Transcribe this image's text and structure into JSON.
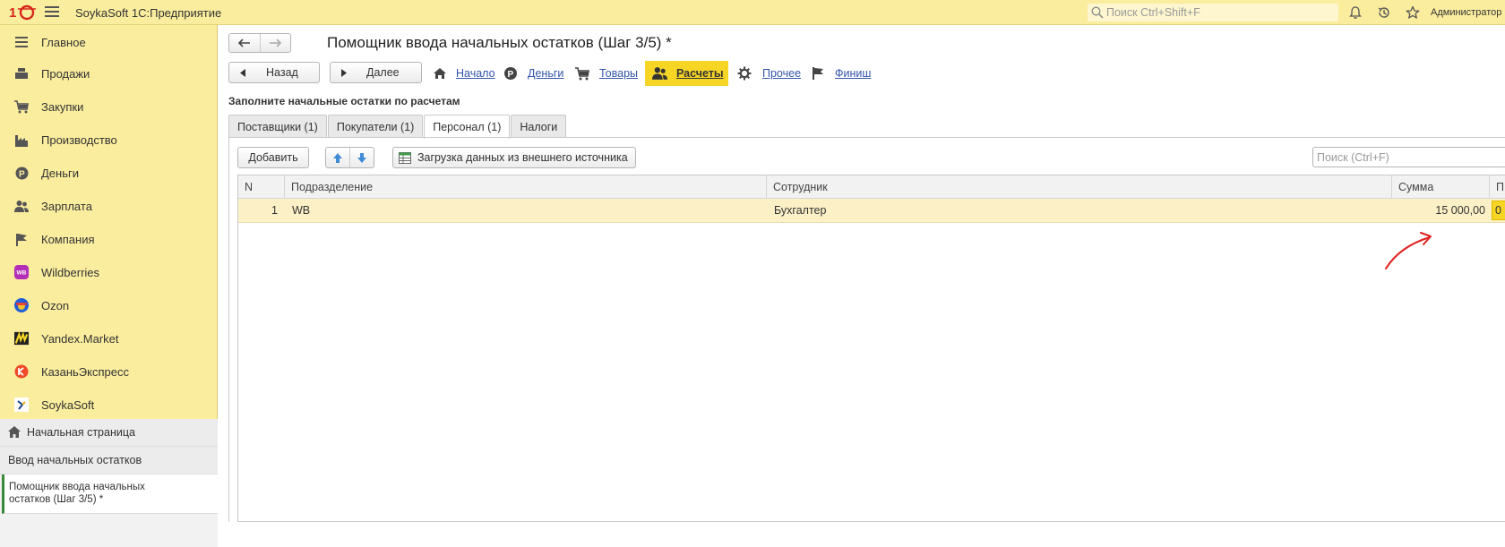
{
  "app": {
    "title": "SoykaSoft 1С:Предприятие",
    "search_placeholder": "Поиск Ctrl+Shift+F",
    "user": "Администратор",
    "accent": "#fbed9e"
  },
  "sidebar": {
    "items": [
      {
        "label": "Главное",
        "icon": "menu-lines-icon"
      },
      {
        "label": "Продажи",
        "icon": "cash-register-icon"
      },
      {
        "label": "Закупки",
        "icon": "cart-icon"
      },
      {
        "label": "Производство",
        "icon": "factory-icon"
      },
      {
        "label": "Деньги",
        "icon": "ruble-coin-icon"
      },
      {
        "label": "Зарплата",
        "icon": "people-icon"
      },
      {
        "label": "Компания",
        "icon": "flag-icon"
      },
      {
        "label": "Wildberries",
        "icon": "wildberries-logo-icon"
      },
      {
        "label": "Ozon",
        "icon": "ozon-logo-icon"
      },
      {
        "label": "Yandex.Market",
        "icon": "yandex-market-logo-icon"
      },
      {
        "label": "КазаньЭкспресс",
        "icon": "kazanexpress-logo-icon"
      },
      {
        "label": "SoykaSoft",
        "icon": "soykasoft-logo-icon"
      }
    ],
    "home": "Начальная страница",
    "open_windows": [
      "Ввод начальных остатков",
      "Помощник ввода начальных остатков (Шаг 3/5) *"
    ]
  },
  "form": {
    "title": "Помощник ввода начальных остатков (Шаг 3/5) *",
    "back_label": "Назад",
    "next_label": "Далее",
    "steps": [
      "Начало",
      "Деньги",
      "Товары",
      "Расчеты",
      "Прочее",
      "Финиш"
    ],
    "active_step": "Расчеты",
    "section_title": "Заполните начальные остатки по расчетам",
    "tabs": [
      "Поставщики (1)",
      "Покупатели (1)",
      "Персонал (1)",
      "Налоги"
    ],
    "active_tab": "Персонал (1)",
    "add_label": "Добавить",
    "load_label": "Загрузка данных из внешнего источника",
    "search_placeholder": "Поиск (Ctrl+F)",
    "table": {
      "columns": [
        "N",
        "Подразделение",
        "Сотрудник",
        "Сумма",
        "П"
      ],
      "rows": [
        {
          "n": "1",
          "department": "WB",
          "employee": "Бухгалтер",
          "amount": "15 000,00",
          "extra": "0"
        }
      ]
    }
  }
}
